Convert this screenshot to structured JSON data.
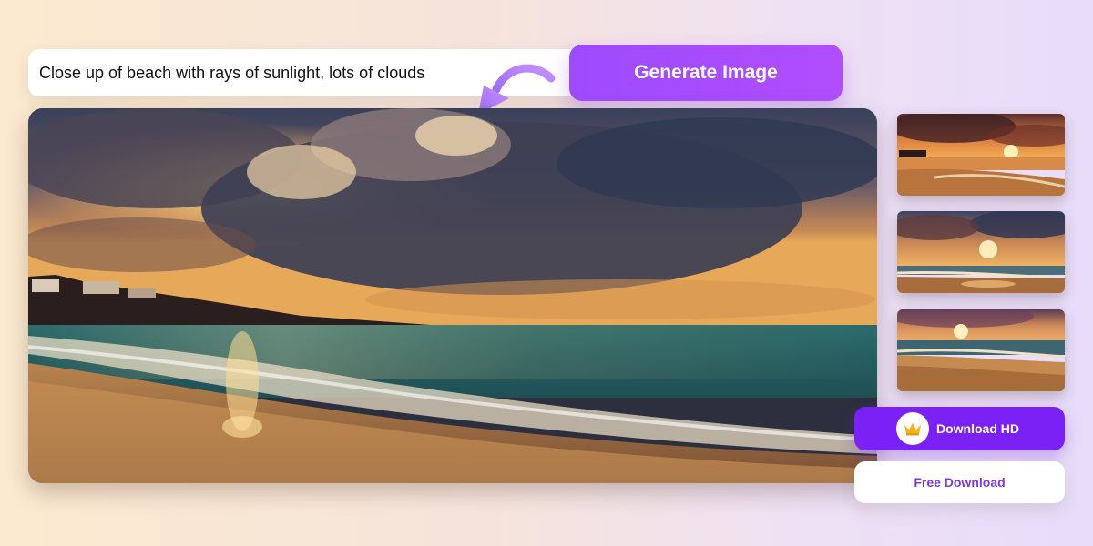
{
  "prompt": {
    "value": "Close up of beach with rays of sunlight, lots of clouds"
  },
  "generate_button": {
    "label": "Generate Image"
  },
  "main_image": {
    "icon": "generated-beach-image"
  },
  "thumbnails": [
    {
      "icon": "beach-sunset-variant-1"
    },
    {
      "icon": "beach-sunset-variant-2"
    },
    {
      "icon": "beach-sunset-variant-3"
    }
  ],
  "download_hd": {
    "label": "Download HD",
    "icon": "crown-icon"
  },
  "free_download": {
    "label": "Free Download"
  },
  "colors": {
    "accent": "#9d4bff",
    "download_hd": "#7a22f5",
    "free_download_text": "#7a3ce0"
  }
}
